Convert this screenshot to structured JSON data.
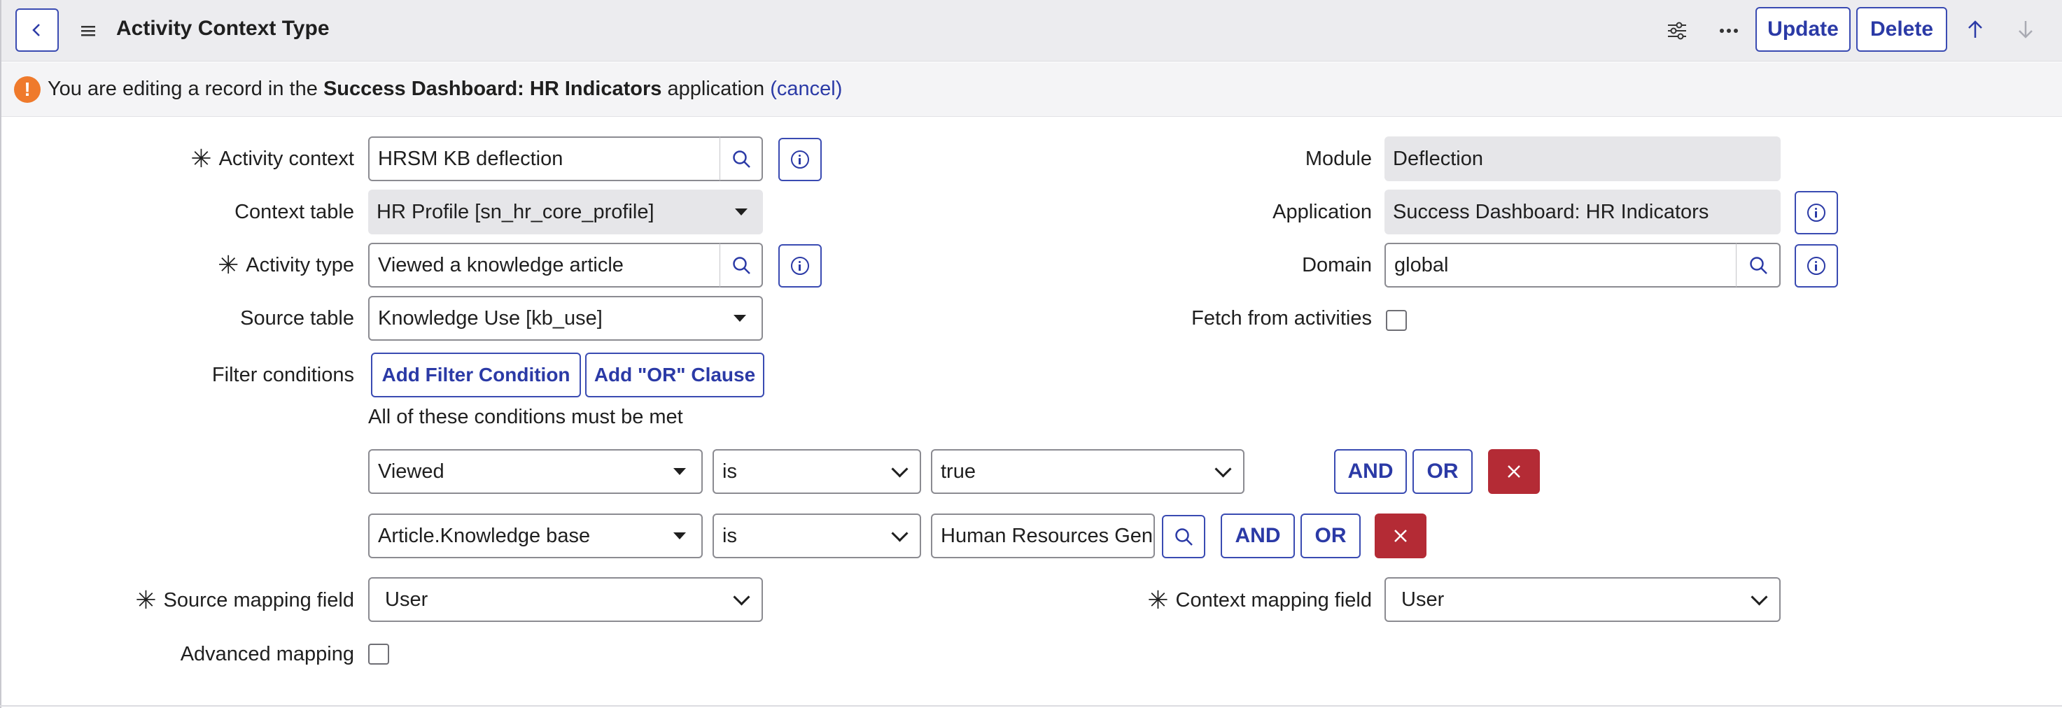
{
  "header": {
    "title": "Activity Context Type",
    "back_icon": "back-icon",
    "menu_icon": "menu-icon",
    "settings_icon": "sliders-icon",
    "more_icon": "more-icon",
    "update_label": "Update",
    "delete_label": "Delete",
    "up_icon": "arrow-up-icon",
    "down_icon": "arrow-down-icon"
  },
  "banner": {
    "prefix": "You are editing a record in the",
    "app_name": "Success Dashboard: HR Indicators",
    "suffix": "application",
    "cancel_label": "(cancel)"
  },
  "form": {
    "activity_context": {
      "label": "Activity context",
      "value": "HRSM KB deflection"
    },
    "context_table": {
      "label": "Context table",
      "value": "HR Profile [sn_hr_core_profile]"
    },
    "activity_type": {
      "label": "Activity type",
      "value": "Viewed a knowledge article"
    },
    "source_table": {
      "label": "Source table",
      "value": "Knowledge Use [kb_use]"
    },
    "filter_conditions": {
      "label": "Filter conditions",
      "add_filter_label": "Add Filter Condition",
      "add_or_label": "Add \"OR\" Clause",
      "all_met_text": "All of these conditions must be met",
      "rows": [
        {
          "field": "Viewed",
          "operator": "is",
          "value": "true",
          "and_label": "AND",
          "or_label": "OR"
        },
        {
          "field": "Article.Knowledge base",
          "operator": "is",
          "value": "Human Resources Gene",
          "and_label": "AND",
          "or_label": "OR"
        }
      ]
    },
    "source_mapping_field": {
      "label": "Source mapping field",
      "value": "User"
    },
    "advanced_mapping": {
      "label": "Advanced mapping",
      "checked": false
    },
    "module": {
      "label": "Module",
      "value": "Deflection"
    },
    "application": {
      "label": "Application",
      "value": "Success Dashboard: HR Indicators"
    },
    "domain": {
      "label": "Domain",
      "value": "global"
    },
    "fetch_from_activities": {
      "label": "Fetch from activities",
      "checked": false
    },
    "context_mapping_field": {
      "label": "Context mapping field",
      "value": "User"
    }
  },
  "colors": {
    "accent": "#2b3aa6",
    "danger": "#b42b35",
    "warning": "#ef7a2c",
    "header_bg": "#ececef"
  }
}
